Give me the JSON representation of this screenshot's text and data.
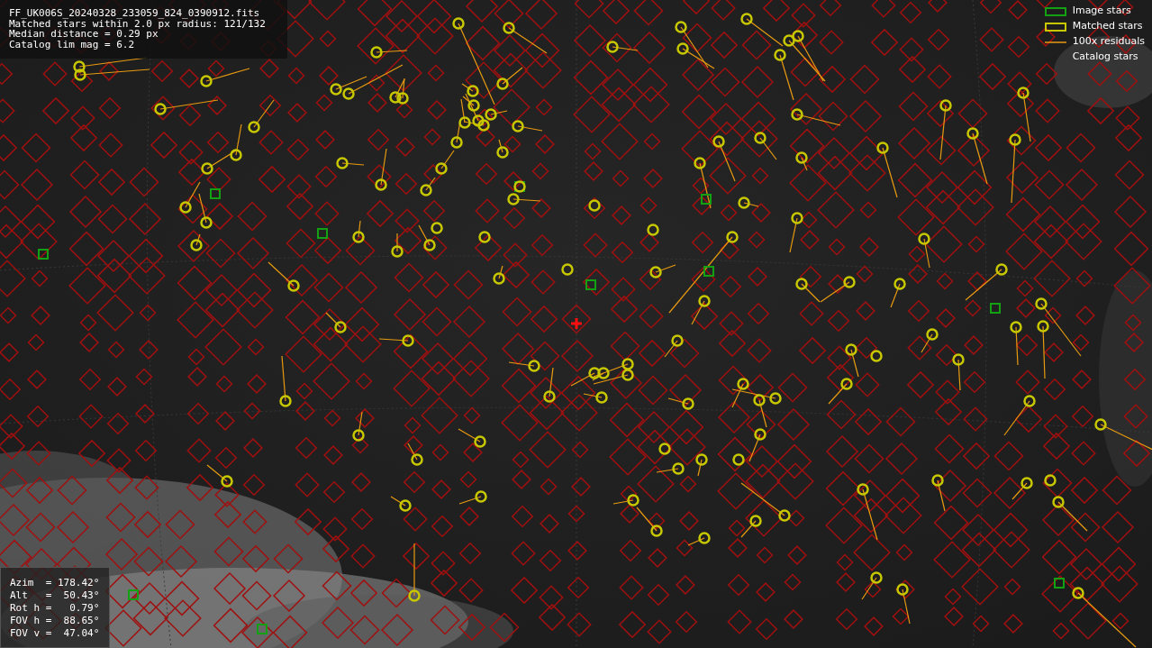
{
  "info": {
    "lines": [
      "FF_UK006S_20240328_233059_824_0390912.fits",
      "Matched stars within 2.0 px radius: 121/132",
      "Median distance = 0.29 px",
      "Catalog lim mag = 6.2"
    ]
  },
  "legend": [
    {
      "kind": "image_stars",
      "label": "Image stars"
    },
    {
      "kind": "matched_stars",
      "label": "Matched stars"
    },
    {
      "kind": "residuals",
      "label": "100x residuals"
    },
    {
      "kind": "catalog_stars",
      "label": "Catalog stars"
    }
  ],
  "pointing": {
    "lines": [
      "Azim  = 178.42°",
      "Alt   =  50.43°",
      "Rot h =   0.79°",
      "FOV h =  88.65°",
      "FOV v =  47.04°"
    ]
  }
}
